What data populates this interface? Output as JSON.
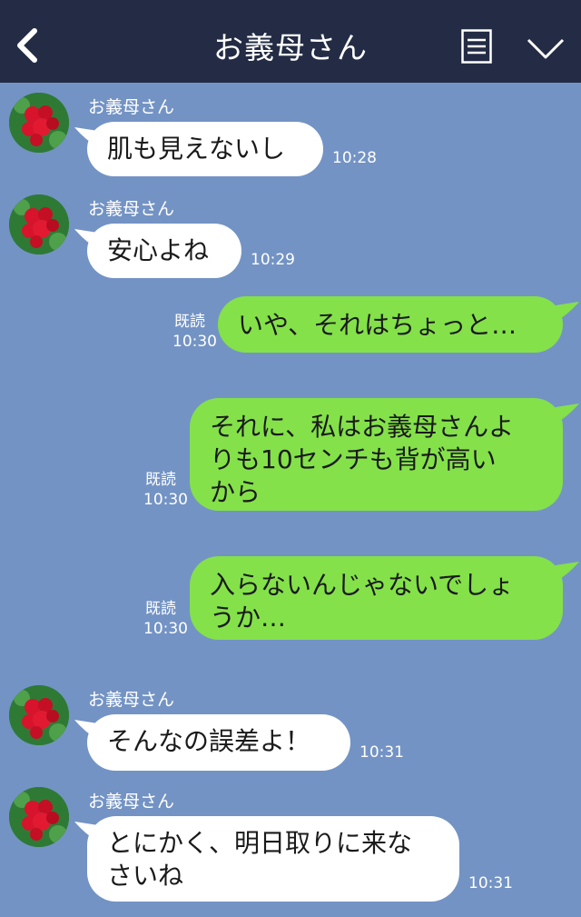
{
  "header": {
    "title": "お義母さん"
  },
  "icons": {
    "back": "chevron-left-icon",
    "menu": "list-icon",
    "expand": "chevron-down-icon"
  },
  "colors": {
    "header": "#232c44",
    "background": "#7393c4",
    "outgoing": "#84e14a",
    "incoming": "#ffffff"
  },
  "messages": [
    {
      "direction": "in",
      "sender": "お義母さん",
      "text": "肌も見えないし",
      "time": "10:28"
    },
    {
      "direction": "in",
      "sender": "お義母さん",
      "text": "安心よね",
      "time": "10:29"
    },
    {
      "direction": "out",
      "read": "既読",
      "text": "いや、それはちょっと…",
      "time": "10:30"
    },
    {
      "direction": "out",
      "read": "既読",
      "lines": [
        "それに、私はお義母さんよ",
        "りも10センチも背が高い",
        "から"
      ],
      "time": "10:30"
    },
    {
      "direction": "out",
      "read": "既読",
      "lines": [
        "入らないんじゃないでしょ",
        "うか…"
      ],
      "time": "10:30"
    },
    {
      "direction": "in",
      "sender": "お義母さん",
      "text": "そんなの誤差よ！",
      "time": "10:31"
    },
    {
      "direction": "in",
      "sender": "お義母さん",
      "lines": [
        "とにかく、明日取りに来な",
        "さいね"
      ],
      "time": "10:31"
    }
  ]
}
